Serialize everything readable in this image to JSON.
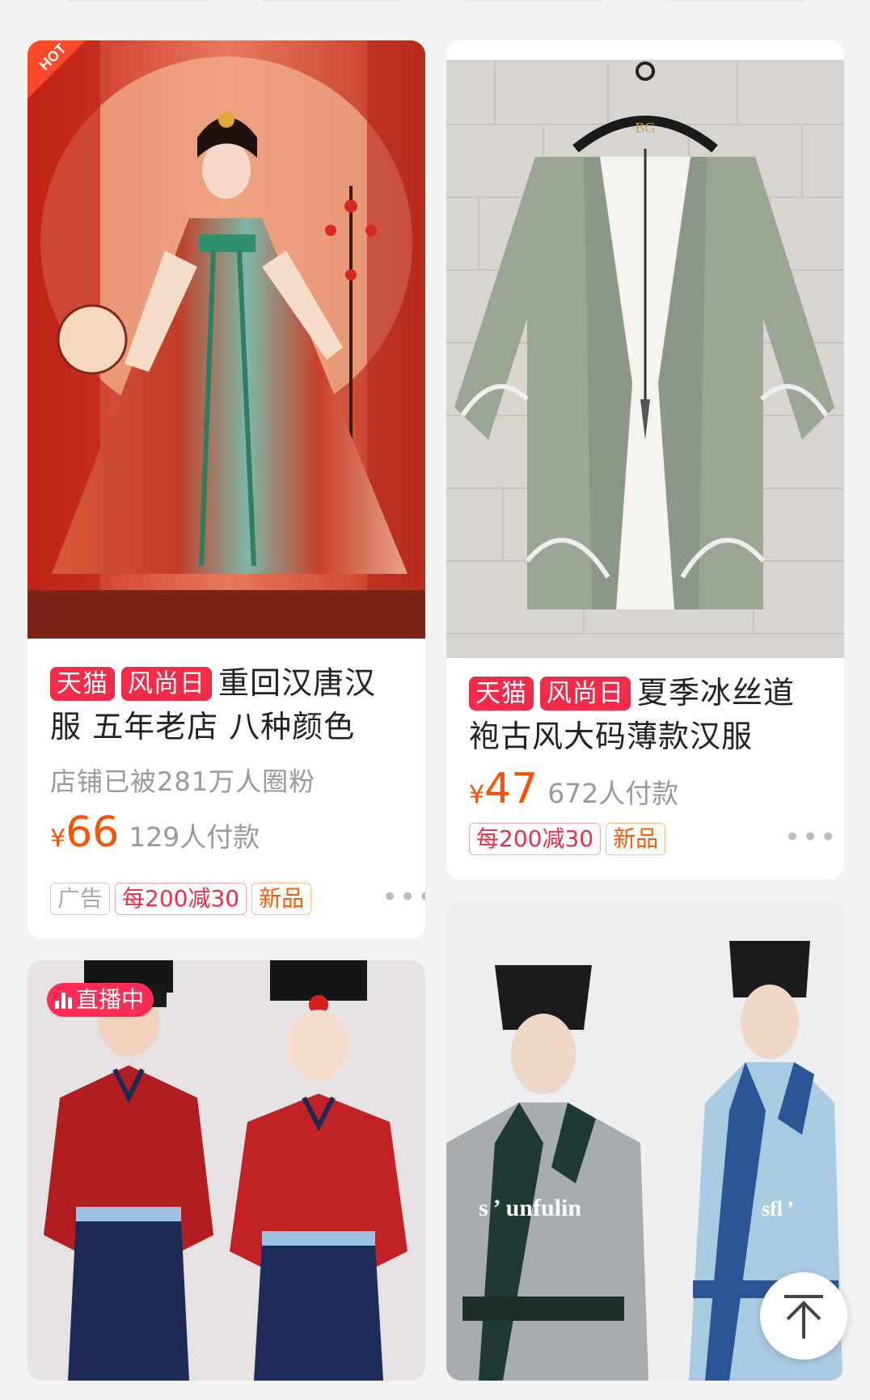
{
  "cards": [
    {
      "tags": [
        "天猫",
        "风尚日"
      ],
      "title": "重回汉唐汉服 五年老店 八种颜色",
      "shop_info": "店铺已被281万人圈粉",
      "currency": "¥",
      "price": "66",
      "paid": "129人付款",
      "badges": [
        "广告",
        "每200减30",
        "新品"
      ],
      "corner_label": "HOT",
      "more": "•••"
    },
    {
      "tags": [
        "天猫",
        "风尚日"
      ],
      "title": "夏季冰丝道袍古风大码薄款汉服",
      "currency": "¥",
      "price": "47",
      "paid": "672人付款",
      "badges": [
        "每200减30",
        "新品"
      ],
      "hanger_logo": "BG",
      "more": "•••"
    },
    {
      "live_label": "直播中"
    },
    {
      "watermark": "s ’ unfulin",
      "watermark2": "sfl ’"
    }
  ],
  "colors": {
    "price": "#ff5000",
    "tag_bg": "#f22b48",
    "live_bg": "#ff2d55"
  },
  "icons": [
    "back-to-top-icon",
    "more-dots-icon",
    "live-bars-icon",
    "hot-corner-icon"
  ]
}
